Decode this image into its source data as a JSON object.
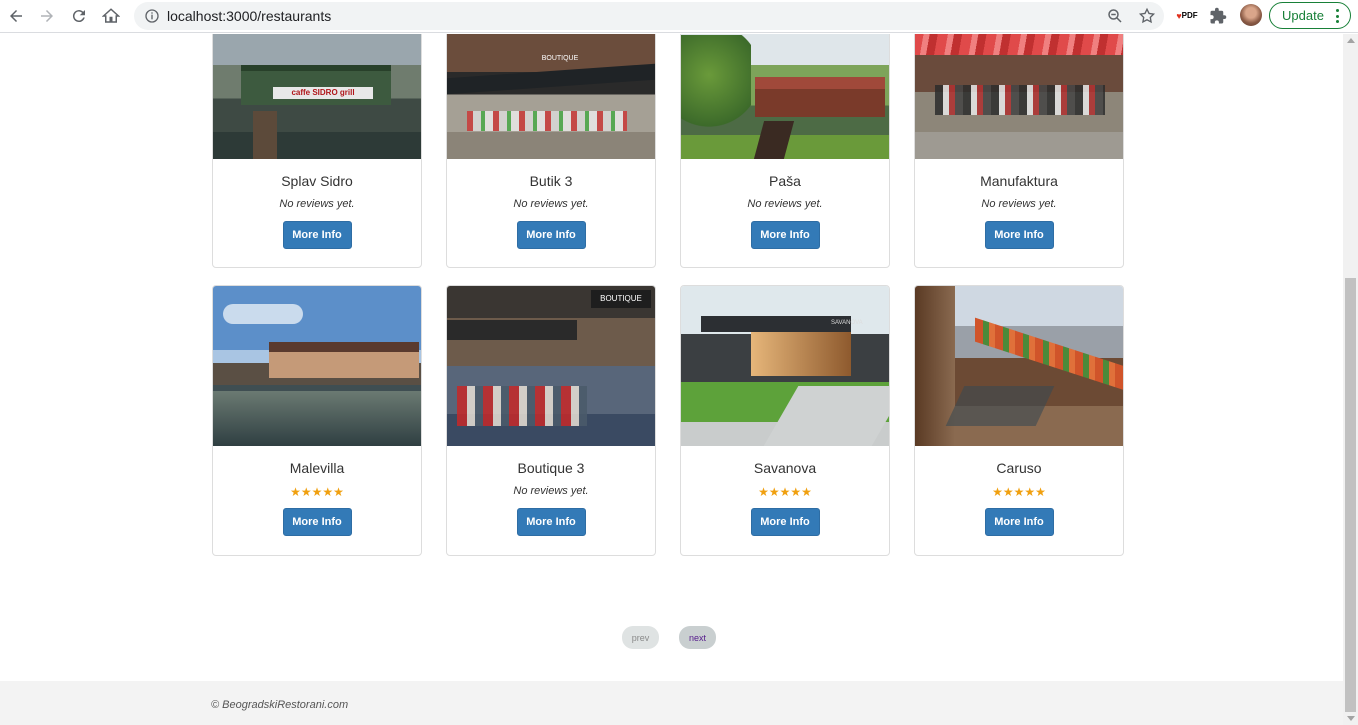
{
  "browser": {
    "url": "localhost:3000/restaurants",
    "update_label": "Update",
    "pdf_label": "PDF"
  },
  "restaurants": [
    {
      "name": "Splav Sidro",
      "reviews": "No reviews yet.",
      "rating": 0,
      "button": "More Info",
      "sign": "caffe SIDRO grill"
    },
    {
      "name": "Butik 3",
      "reviews": "No reviews yet.",
      "rating": 0,
      "button": "More Info",
      "sign": "BOUTIQUE"
    },
    {
      "name": "Paša",
      "reviews": "No reviews yet.",
      "rating": 0,
      "button": "More Info",
      "sign": ""
    },
    {
      "name": "Manufaktura",
      "reviews": "No reviews yet.",
      "rating": 0,
      "button": "More Info",
      "sign": ""
    },
    {
      "name": "Malevilla",
      "reviews": "",
      "rating": 5,
      "stars": "★★★★★",
      "button": "More Info",
      "sign": ""
    },
    {
      "name": "Boutique 3",
      "reviews": "No reviews yet.",
      "rating": 0,
      "button": "More Info",
      "sign": "BOUTIQUE"
    },
    {
      "name": "Savanova",
      "reviews": "",
      "rating": 5,
      "stars": "★★★★★",
      "button": "More Info",
      "sign": "SAVANOVA"
    },
    {
      "name": "Caruso",
      "reviews": "",
      "rating": 5,
      "stars": "★★★★★",
      "button": "More Info",
      "sign": ""
    }
  ],
  "pagination": {
    "prev": "prev",
    "next": "next"
  },
  "footer": {
    "copyright": "© BeogradskiRestorani.com"
  },
  "colors": {
    "primary": "#337ab7",
    "star": "#f0a010",
    "update": "#188038"
  }
}
